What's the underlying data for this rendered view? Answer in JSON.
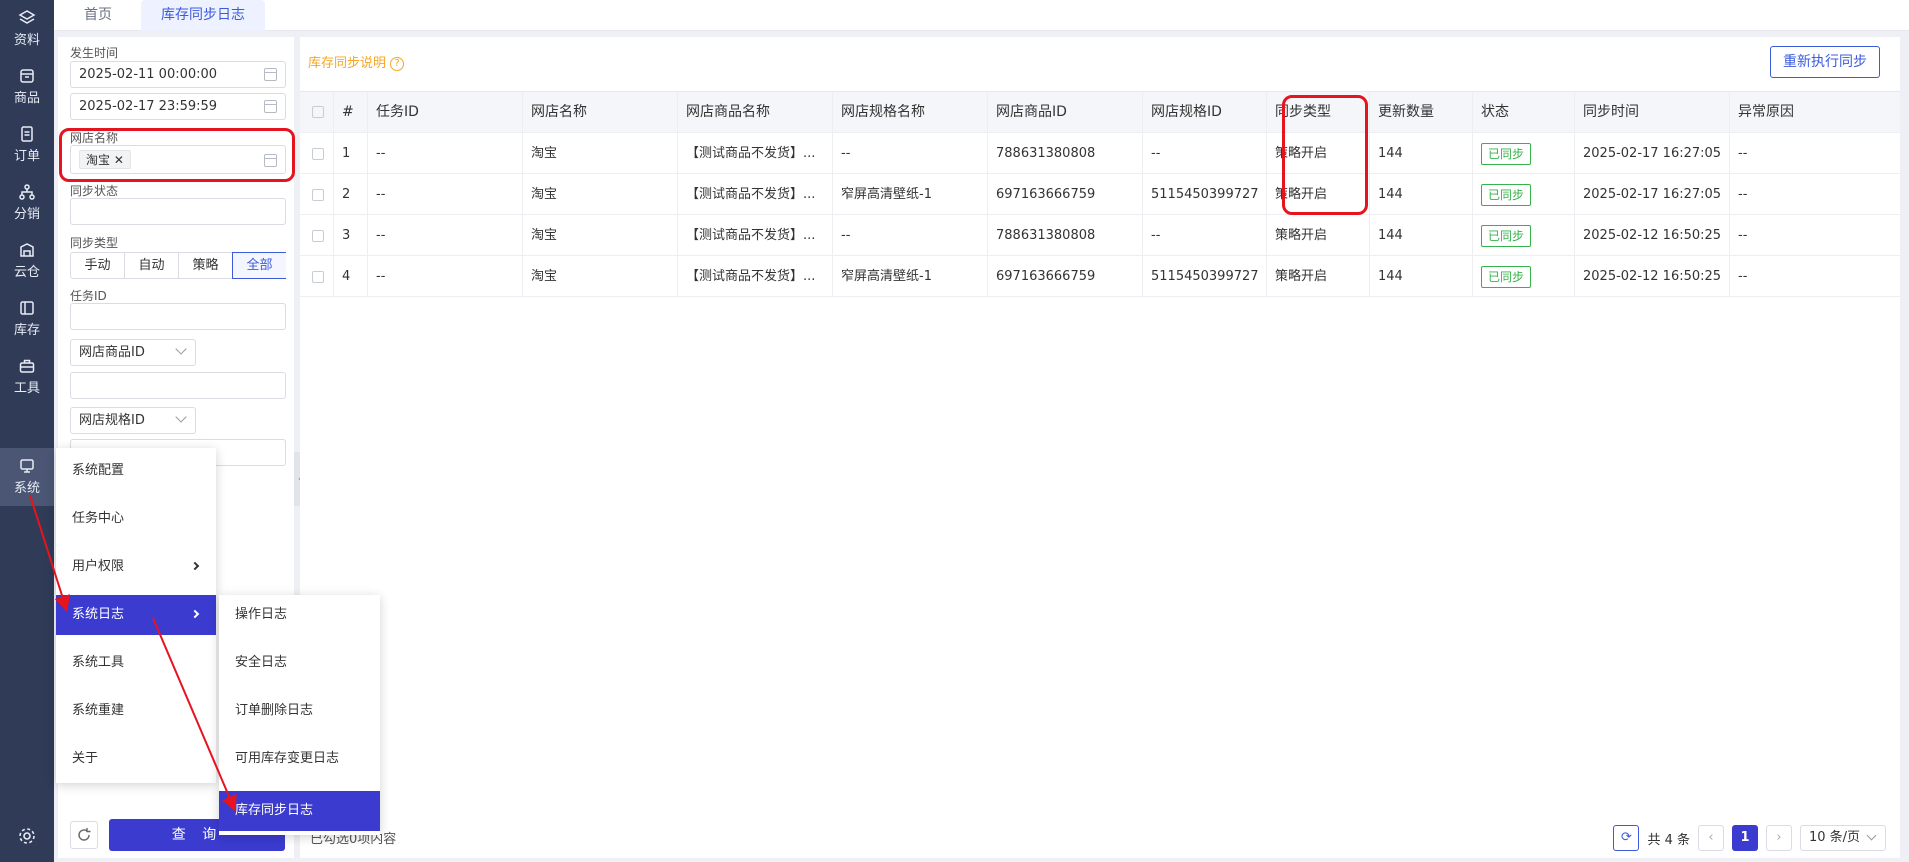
{
  "nav": {
    "items": [
      {
        "label": "资料",
        "icon": "layers-icon"
      },
      {
        "label": "商品",
        "icon": "box-icon"
      },
      {
        "label": "订单",
        "icon": "document-icon"
      },
      {
        "label": "分销",
        "icon": "network-icon"
      },
      {
        "label": "云仓",
        "icon": "warehouse-icon"
      },
      {
        "label": "库存",
        "icon": "inventory-icon"
      },
      {
        "label": "工具",
        "icon": "toolbox-icon"
      },
      {
        "label": "系统",
        "icon": "monitor-icon"
      }
    ],
    "settings_icon": "gear-icon"
  },
  "tabs": [
    "首页",
    "库存同步日志"
  ],
  "filter": {
    "time_label": "发生时间",
    "time_start": "2025-02-11 00:00:00",
    "time_end": "2025-02-17 23:59:59",
    "shop_label": "网店名称",
    "shop_tag": "淘宝",
    "sync_status_label": "同步状态",
    "sync_type_label": "同步类型",
    "sync_type_options": [
      "手动",
      "自动",
      "策略",
      "全部"
    ],
    "sync_type_selected": "全部",
    "task_id_label": "任务ID",
    "goods_id_select": "网店商品ID",
    "spec_id_select": "网店规格ID",
    "query_label": "查 询"
  },
  "main": {
    "help_link": "库存同步说明",
    "rerun_label": "重新执行同步",
    "columns": [
      "#",
      "任务ID",
      "网店名称",
      "网店商品名称",
      "网店规格名称",
      "网店商品ID",
      "网店规格ID",
      "同步类型",
      "更新数量",
      "状态",
      "同步时间",
      "异常原因"
    ],
    "rows": [
      [
        "1",
        "--",
        "淘宝",
        "【测试商品不发货】...",
        "--",
        "788631380808",
        "--",
        "策略开启",
        "144",
        "已同步",
        "2025-02-17 16:27:05",
        "--"
      ],
      [
        "2",
        "--",
        "淘宝",
        "【测试商品不发货】...",
        "窄屏高清壁纸-1",
        "697163666759",
        "5115450399727",
        "策略开启",
        "144",
        "已同步",
        "2025-02-17 16:27:05",
        "--"
      ],
      [
        "3",
        "--",
        "淘宝",
        "【测试商品不发货】...",
        "--",
        "788631380808",
        "--",
        "策略开启",
        "144",
        "已同步",
        "2025-02-12 16:50:25",
        "--"
      ],
      [
        "4",
        "--",
        "淘宝",
        "【测试商品不发货】...",
        "窄屏高清壁纸-1",
        "697163666759",
        "5115450399727",
        "策略开启",
        "144",
        "已同步",
        "2025-02-12 16:50:25",
        "--"
      ]
    ],
    "selected_text": "已勾选0项内容",
    "total_text": "共 4 条",
    "current_page": "1",
    "page_size": "10 条/页"
  },
  "system_menu": {
    "items": [
      "系统配置",
      "任务中心",
      "用户权限",
      "系统日志",
      "系统工具",
      "系统重建",
      "关于"
    ],
    "active": "系统日志"
  },
  "log_submenu": {
    "items": [
      "操作日志",
      "安全日志",
      "订单删除日志",
      "可用库存变更日志",
      "库存同步日志"
    ],
    "active": "库存同步日志"
  },
  "colors": {
    "nav_bg": "#2f3b57",
    "primary": "#3b3bd0",
    "highlight_red": "#e5141f",
    "status_green": "#36b34a",
    "help_orange": "#f5a623"
  }
}
